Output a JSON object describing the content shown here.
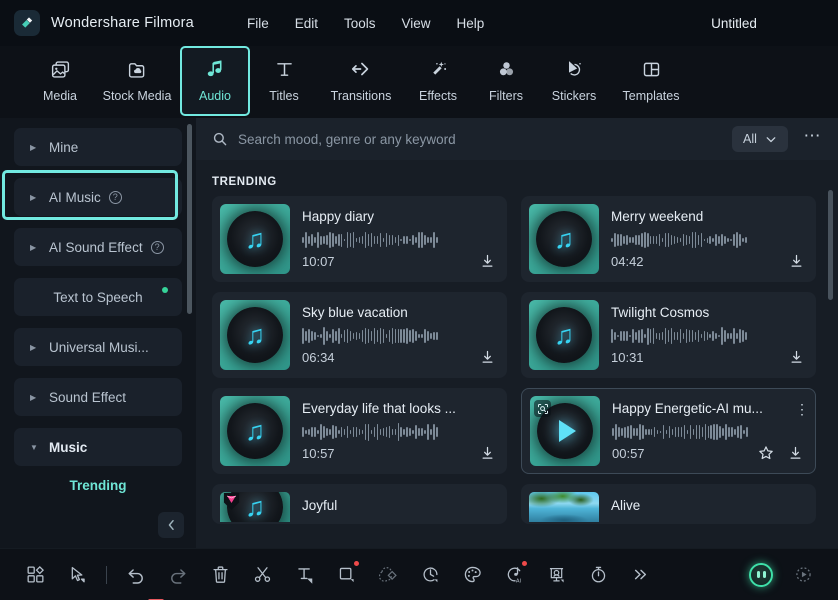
{
  "titlebar": {
    "logo_icon": "filmora-diamond-icon",
    "brand": "Wondershare Filmora",
    "menus": [
      "File",
      "Edit",
      "Tools",
      "View",
      "Help"
    ],
    "document_title": "Untitled"
  },
  "tabs": [
    {
      "label": "Media",
      "icon": "image-stack-icon",
      "active": false
    },
    {
      "label": "Stock Media",
      "icon": "cloud-folder-icon",
      "active": false
    },
    {
      "label": "Audio",
      "icon": "music-note-icon",
      "active": true
    },
    {
      "label": "Titles",
      "icon": "text-t-icon",
      "active": false
    },
    {
      "label": "Transitions",
      "icon": "transition-arrows-icon",
      "active": false
    },
    {
      "label": "Effects",
      "icon": "magic-wand-icon",
      "active": false
    },
    {
      "label": "Filters",
      "icon": "three-circles-icon",
      "active": false
    },
    {
      "label": "Stickers",
      "icon": "sticker-arrow-icon",
      "active": false
    },
    {
      "label": "Templates",
      "icon": "layout-grid-icon",
      "active": false
    }
  ],
  "sidebar": {
    "items": [
      {
        "label": "Mine",
        "caret": true,
        "help": false,
        "dot": false,
        "selected": false,
        "bold": false
      },
      {
        "label": "AI Music",
        "caret": true,
        "help": true,
        "dot": false,
        "selected": true,
        "bold": false
      },
      {
        "label": "AI Sound Effect",
        "caret": true,
        "help": true,
        "dot": false,
        "selected": false,
        "bold": false
      },
      {
        "label": "Text to Speech",
        "caret": false,
        "help": false,
        "dot": true,
        "selected": false,
        "bold": false
      },
      {
        "label": "Universal Musi...",
        "caret": true,
        "help": false,
        "dot": false,
        "selected": false,
        "bold": false
      },
      {
        "label": "Sound Effect",
        "caret": true,
        "help": false,
        "dot": false,
        "selected": false,
        "bold": false
      },
      {
        "label": "Music",
        "caret": true,
        "help": false,
        "dot": false,
        "selected": false,
        "bold": true
      }
    ],
    "sub_link": "Trending",
    "collapse_icon": "chevron-left-icon",
    "highlight_color": "#72e9e0"
  },
  "search": {
    "icon": "search-icon",
    "placeholder": "Search mood, genre or any keyword",
    "value": "",
    "filter_label": "All",
    "filter_caret_icon": "chevron-down-icon",
    "more_icon": "kebab-horizontal-icon"
  },
  "content": {
    "section_label": "TRENDING",
    "cards": [
      {
        "title": "Happy diary",
        "duration": "10:07",
        "thumb": "vinyl-note",
        "badge": "",
        "menu": false,
        "star": false,
        "download": true,
        "partial": false
      },
      {
        "title": "Merry weekend",
        "duration": "04:42",
        "thumb": "vinyl-note",
        "badge": "",
        "menu": false,
        "star": false,
        "download": true,
        "partial": false
      },
      {
        "title": "Sky blue vacation",
        "duration": "06:34",
        "thumb": "vinyl-note",
        "badge": "",
        "menu": false,
        "star": false,
        "download": true,
        "partial": false
      },
      {
        "title": "Twilight Cosmos",
        "duration": "10:31",
        "thumb": "vinyl-note",
        "badge": "",
        "menu": false,
        "star": false,
        "download": true,
        "partial": false
      },
      {
        "title": "Everyday life that looks ...",
        "duration": "10:57",
        "thumb": "vinyl-note",
        "badge": "",
        "menu": false,
        "star": false,
        "download": true,
        "partial": false
      },
      {
        "title": "Happy Energetic-AI mu...",
        "duration": "00:57",
        "thumb": "vinyl-play",
        "badge": "ai-scan",
        "menu": true,
        "star": true,
        "download": true,
        "partial": false
      },
      {
        "title": "Joyful",
        "duration": "",
        "thumb": "vinyl-note",
        "badge": "gem",
        "menu": false,
        "star": false,
        "download": false,
        "partial": true
      },
      {
        "title": "Alive",
        "duration": "",
        "thumb": "photo",
        "badge": "",
        "menu": false,
        "star": false,
        "download": false,
        "partial": true
      }
    ]
  },
  "bottom_toolbar": {
    "tools": [
      {
        "icon": "grid-shapes-icon",
        "dim": false,
        "badge": false
      },
      {
        "icon": "cursor-select-icon",
        "dim": false,
        "badge": false
      },
      {
        "icon": "undo-arrow-icon",
        "dim": false,
        "badge": false
      },
      {
        "icon": "redo-arrow-icon",
        "dim": true,
        "badge": false
      },
      {
        "icon": "trash-icon",
        "dim": false,
        "badge": false
      },
      {
        "icon": "scissors-split-icon",
        "dim": false,
        "badge": false
      },
      {
        "icon": "text-tool-icon",
        "dim": false,
        "badge": false
      },
      {
        "icon": "crop-tool-icon",
        "dim": false,
        "badge": true
      },
      {
        "icon": "mask-shapes-icon",
        "dim": true,
        "badge": false
      },
      {
        "icon": "speed-ramp-icon",
        "dim": false,
        "badge": false
      },
      {
        "icon": "color-palette-icon",
        "dim": false,
        "badge": false
      },
      {
        "icon": "ai-audio-icon",
        "dim": false,
        "badge": true
      },
      {
        "icon": "green-screen-icon",
        "dim": false,
        "badge": false
      },
      {
        "icon": "stopwatch-icon",
        "dim": false,
        "badge": false
      },
      {
        "icon": "chevron-double-right-icon",
        "dim": false,
        "badge": false
      }
    ],
    "ai_assistant_icon": "ai-orb-icon",
    "render_preview_icon": "render-preview-icon"
  },
  "colors": {
    "accent": "#6fe6d6",
    "highlight": "#72e9e0",
    "titlebar_bg": "#0a0e14",
    "panel_bg": "#171d25",
    "sidebar_bg": "#11161d",
    "card_bg": "#1e252e",
    "badge_red": "#ef4a4a",
    "dot_green": "#36d399",
    "gem_pink": "#f43f8e"
  }
}
